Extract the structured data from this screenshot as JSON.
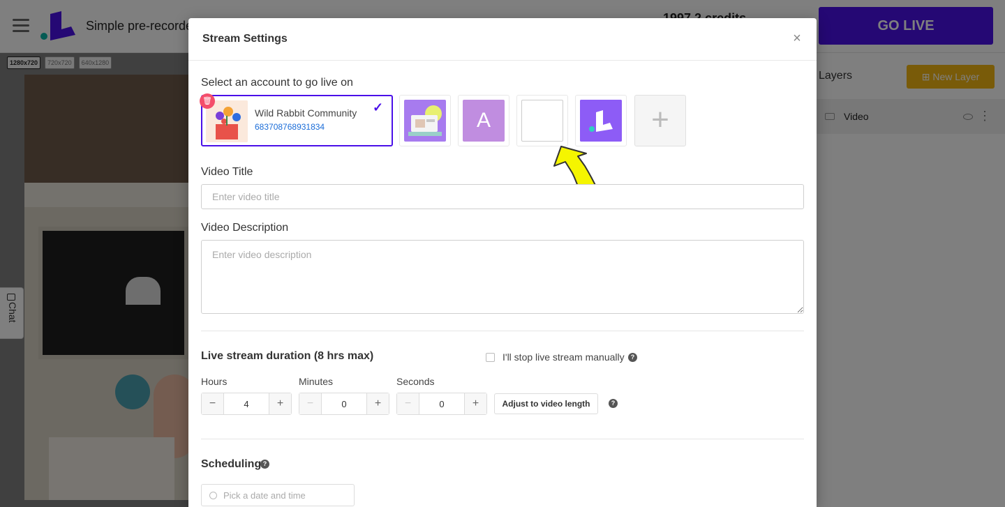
{
  "app": {
    "title": "Simple pre-recorde",
    "credits": "1997.2 credits",
    "go_live_label": "GO LIVE",
    "resolutions": [
      "1280x720",
      "720x720",
      "640x1280"
    ],
    "active_resolution": "1280x720",
    "chat_label": "Chat"
  },
  "layers": {
    "title": "Layers",
    "new_layer_label": "New Layer",
    "items": [
      {
        "name": "Video"
      }
    ]
  },
  "modal": {
    "title": "Stream Settings",
    "close_icon": "close-icon",
    "account_section_label": "Select an account to go live on",
    "selected_account": {
      "name": "Wild Rabbit Community",
      "id": "683708768931834"
    },
    "other_accounts": [
      {
        "type": "image",
        "icon": "photo-thumbnail"
      },
      {
        "type": "letter",
        "letter": "A"
      },
      {
        "type": "broken-image",
        "icon": "broken-image-icon"
      },
      {
        "type": "logo",
        "icon": "app-logo-icon"
      }
    ],
    "add_account_icon": "plus-icon",
    "video_title_label": "Video Title",
    "video_title_placeholder": "Enter video title",
    "video_description_label": "Video Description",
    "video_description_placeholder": "Enter video description",
    "duration": {
      "title": "Live stream duration (8 hrs max)",
      "manual_stop_label": "I'll stop live stream manually",
      "manual_stop_checked": false,
      "hours_label": "Hours",
      "minutes_label": "Minutes",
      "seconds_label": "Seconds",
      "hours": "4",
      "minutes": "0",
      "seconds": "0",
      "adjust_label": "Adjust to video length"
    },
    "scheduling": {
      "title": "Scheduling",
      "date_placeholder": "Pick a date and time"
    }
  },
  "colors": {
    "accent": "#4a10e8",
    "new_layer": "#f2b713",
    "delete_badge": "#f44e6b",
    "account_id": "#1a6cd8",
    "annotation_arrow": "#f5f500"
  }
}
